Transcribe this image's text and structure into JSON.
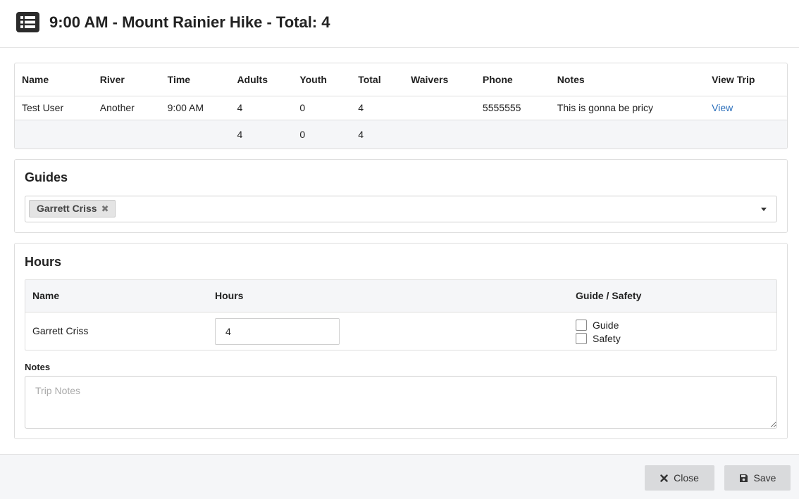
{
  "header": {
    "title": "9:00 AM - Mount Rainier Hike - Total: 4",
    "icon": "list-icon"
  },
  "trips_table": {
    "columns": [
      "Name",
      "River",
      "Time",
      "Adults",
      "Youth",
      "Total",
      "Waivers",
      "Phone",
      "Notes",
      "View Trip"
    ],
    "rows": [
      {
        "name": "Test User",
        "river": "Another",
        "time": "9:00 AM",
        "adults": "4",
        "youth": "0",
        "total": "4",
        "waivers": "",
        "phone": "5555555",
        "notes": "This is gonna be pricy",
        "view": "View"
      }
    ],
    "totals": {
      "adults": "4",
      "youth": "0",
      "total": "4"
    }
  },
  "guides": {
    "title": "Guides",
    "selected": [
      "Garrett Criss"
    ],
    "remove_glyph": "✖"
  },
  "hours": {
    "title": "Hours",
    "columns": [
      "Name",
      "Hours",
      "Guide / Safety"
    ],
    "rows": [
      {
        "name": "Garrett Criss",
        "hours": "4",
        "guide_label": "Guide",
        "safety_label": "Safety"
      }
    ],
    "notes_label": "Notes",
    "notes_placeholder": "Trip Notes",
    "notes_value": ""
  },
  "footer": {
    "close_label": "Close",
    "save_label": "Save"
  }
}
